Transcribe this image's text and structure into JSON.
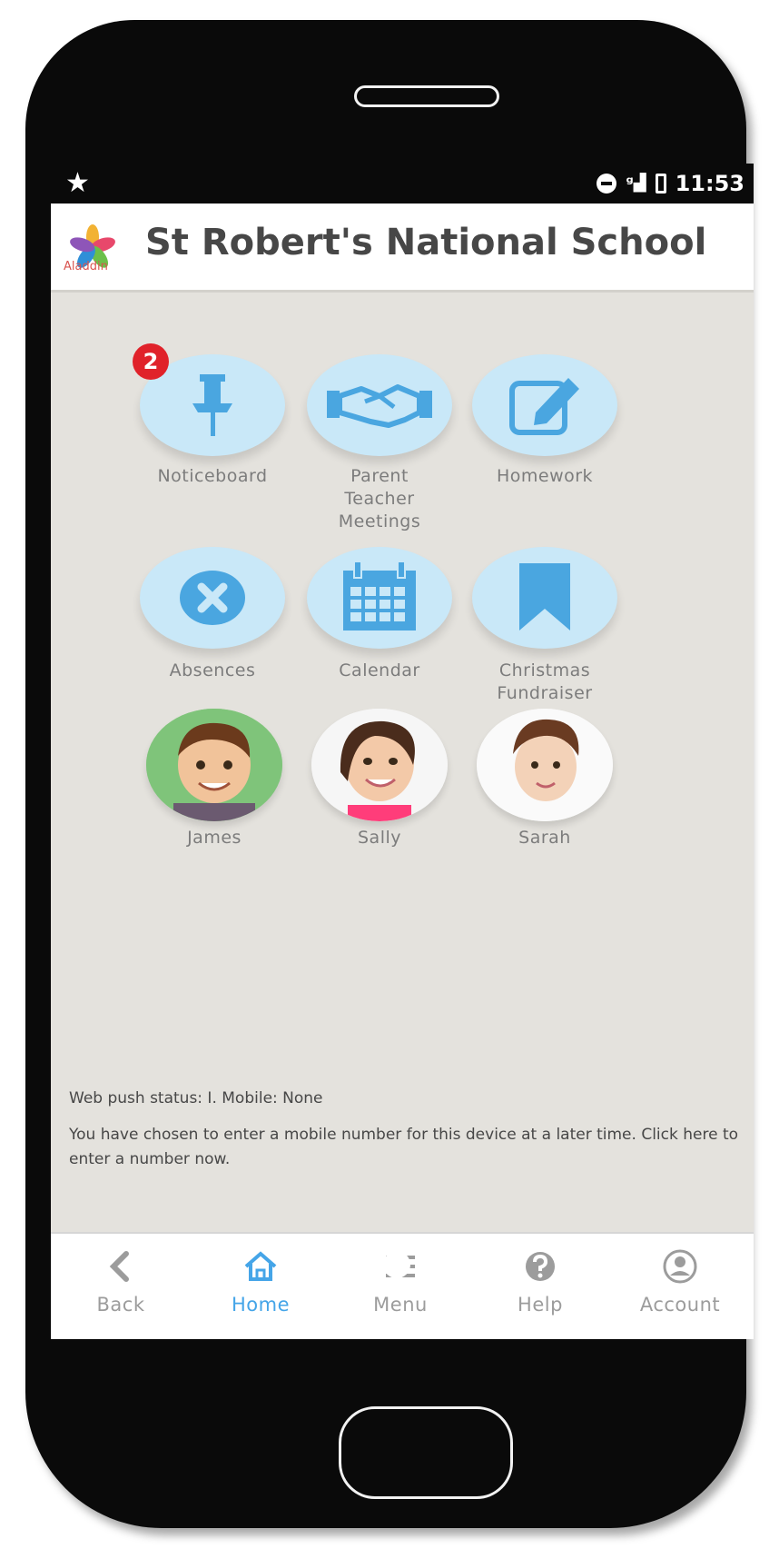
{
  "status_bar": {
    "time": "11:53",
    "left_icon": "star-icon",
    "right_icons": [
      "do-not-disturb-icon",
      "signal-icon",
      "battery-icon"
    ]
  },
  "header": {
    "logo_text": "Aladdin",
    "title": "St Robert's National School"
  },
  "tiles": [
    {
      "label": "Noticeboard",
      "icon": "pushpin-icon",
      "badge": "2"
    },
    {
      "label": "Parent\nTeacher\nMeetings",
      "icon": "handshake-icon"
    },
    {
      "label": "Homework",
      "icon": "edit-icon"
    },
    {
      "label": "Absences",
      "icon": "close-circle-icon"
    },
    {
      "label": "Calendar",
      "icon": "calendar-icon"
    },
    {
      "label": "Christmas\nFundraiser",
      "icon": "bookmark-icon"
    }
  ],
  "children": [
    {
      "name": "James"
    },
    {
      "name": "Sally"
    },
    {
      "name": "Sarah"
    }
  ],
  "notes": {
    "push_status": "Web push status: I. Mobile: None",
    "mobile_prompt": "You have chosen to enter a mobile number for this device at a later time. Click here to enter a number now."
  },
  "tabbar": [
    {
      "label": "Back",
      "icon": "chevron-left-icon",
      "active": false
    },
    {
      "label": "Home",
      "icon": "home-icon",
      "active": true
    },
    {
      "label": "Menu",
      "icon": "menu-icon",
      "active": false
    },
    {
      "label": "Help",
      "icon": "help-icon",
      "active": false
    },
    {
      "label": "Account",
      "icon": "account-icon",
      "active": false
    }
  ],
  "colors": {
    "accent": "#45a5e8",
    "tile_bg": "#c9e8f8",
    "icon_blue": "#4aa6e0",
    "badge": "#e0222a",
    "background": "#e4e2dd"
  }
}
